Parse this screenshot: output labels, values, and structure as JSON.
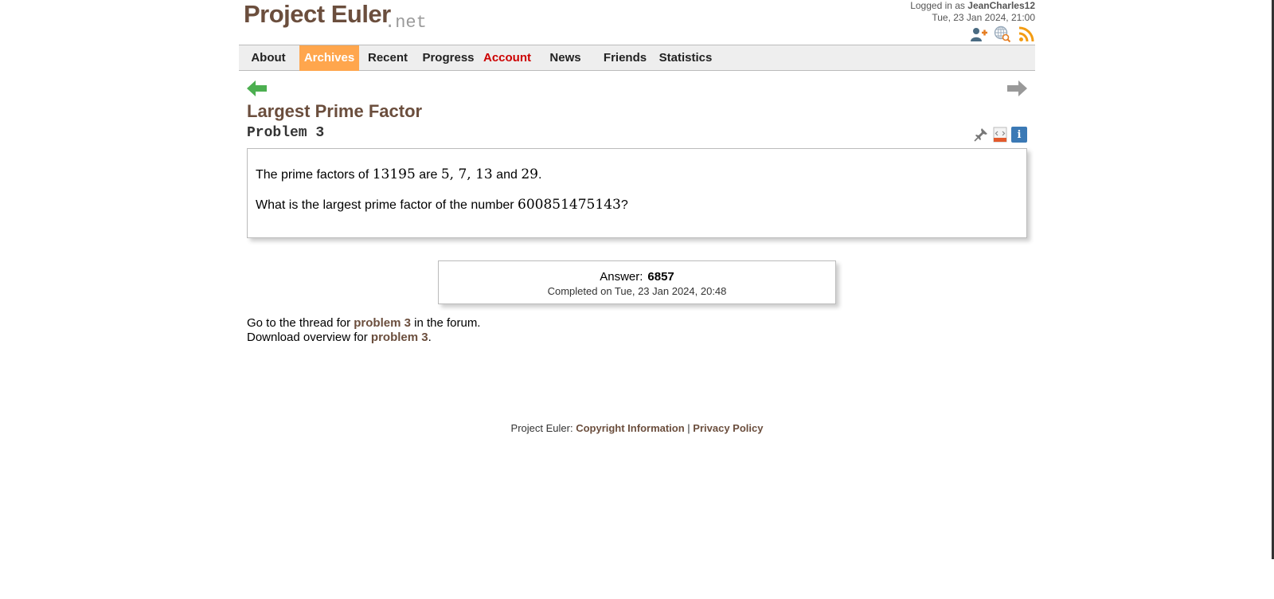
{
  "header": {
    "logo_main": "Project Euler",
    "logo_net": ".net",
    "logged_in_prefix": "Logged in as ",
    "username": "JeanCharles12",
    "datetime": "Tue, 23 Jan 2024, 21:00",
    "icons": [
      "add-friend-icon",
      "search-globe-icon",
      "rss-feed-icon"
    ]
  },
  "nav": {
    "items": [
      {
        "label": "About"
      },
      {
        "label": "Archives"
      },
      {
        "label": "Recent"
      },
      {
        "label": "Progress"
      },
      {
        "label": "Account"
      },
      {
        "label": "News"
      },
      {
        "label": "Friends"
      },
      {
        "label": "Statistics"
      }
    ],
    "active": "Archives"
  },
  "problem": {
    "title": "Largest Prime Factor",
    "number_label": "Problem 3",
    "line1_text_a": "The prime factors of ",
    "line1_num": "13195",
    "line1_text_b": " are ",
    "line1_factors": "5, 7, 13",
    "line1_text_c": " and ",
    "line1_last": "29",
    "line1_end": ".",
    "line2_text": "What is the largest prime factor of the number ",
    "line2_num": "600851475143",
    "line2_end": "?"
  },
  "answer": {
    "label": "Answer:",
    "value": "6857",
    "completed": "Completed on Tue, 23 Jan 2024, 20:48"
  },
  "links": {
    "thread_prefix": "Go to the thread for ",
    "thread_link": "problem 3",
    "thread_suffix": " in the forum.",
    "download_prefix": "Download overview for ",
    "download_link": "problem 3",
    "download_suffix": "."
  },
  "footer": {
    "prefix": "Project Euler: ",
    "copyright": "Copyright Information",
    "sep": " | ",
    "privacy": "Privacy Policy"
  },
  "colors": {
    "brand_brown": "#6b4e3d",
    "active_tab": "#ffa64d",
    "account_red": "#cc0000",
    "nav_arrow_green": "#4caf50",
    "info_blue": "#3b79b5",
    "rss_orange": "#f39c12"
  }
}
